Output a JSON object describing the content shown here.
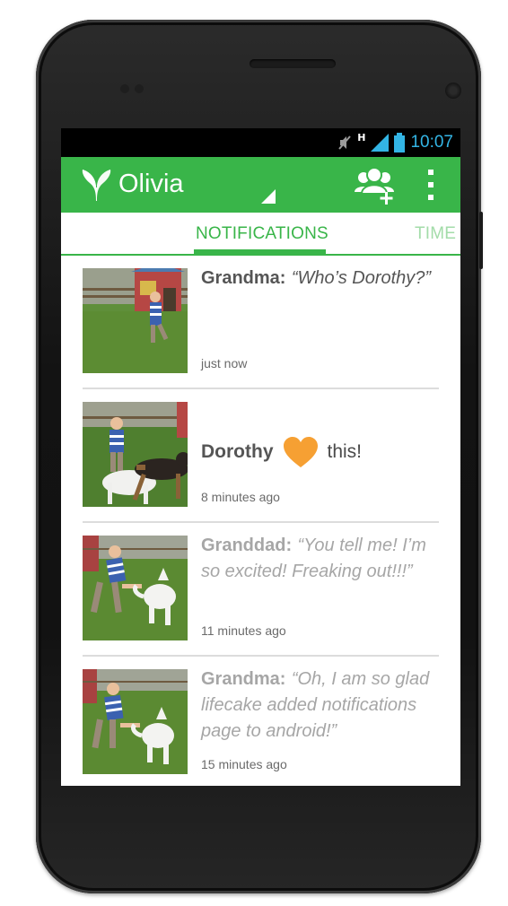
{
  "status": {
    "time": "10:07",
    "network": "H"
  },
  "actionbar": {
    "title": "Olivia"
  },
  "tabs": [
    {
      "label": "NOTIFICATIONS",
      "active": true
    },
    {
      "label": "TIME",
      "active": false
    }
  ],
  "notifications": [
    {
      "author": "Grandma:",
      "quote": "“Who’s Dorothy?”",
      "time": "just now"
    },
    {
      "author": "Dorothy",
      "action": "this!",
      "icon": "heart-icon",
      "time": "8 minutes ago"
    },
    {
      "author": "Granddad:",
      "quote": "“You tell me! I’m so excited! Freaking out!!!”",
      "time": "11 minutes ago"
    },
    {
      "author": "Grandma:",
      "quote": "“Oh, I am so glad lifecake added notifications page to android!”",
      "time": "15 minutes ago"
    }
  ],
  "colors": {
    "brand": "#39b549",
    "status_text": "#33b5e5",
    "heart": "#f6a033"
  }
}
